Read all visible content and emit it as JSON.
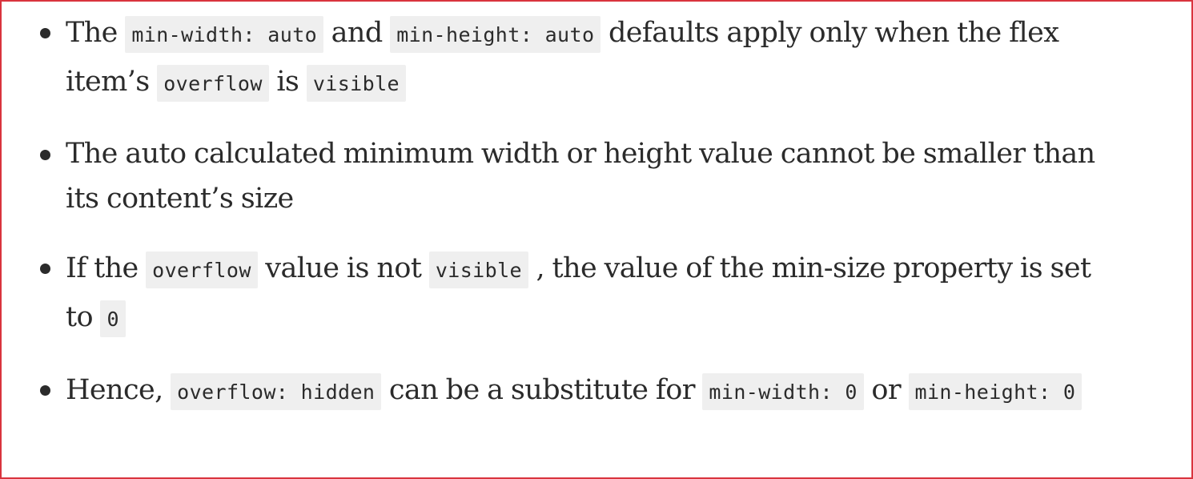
{
  "bullets": [
    {
      "parts": [
        {
          "t": "text",
          "v": "The "
        },
        {
          "t": "code",
          "v": "min-width: auto"
        },
        {
          "t": "text",
          "v": " and "
        },
        {
          "t": "code",
          "v": "min-height: auto"
        },
        {
          "t": "text",
          "v": " defaults apply only when the flex item’s "
        },
        {
          "t": "code",
          "v": "overflow"
        },
        {
          "t": "text",
          "v": " is "
        },
        {
          "t": "code",
          "v": "visible"
        }
      ]
    },
    {
      "parts": [
        {
          "t": "text",
          "v": "The auto calculated minimum width or height value cannot be smaller than its content’s size"
        }
      ]
    },
    {
      "parts": [
        {
          "t": "text",
          "v": "If the "
        },
        {
          "t": "code",
          "v": "overflow"
        },
        {
          "t": "text",
          "v": " value is not "
        },
        {
          "t": "code",
          "v": "visible"
        },
        {
          "t": "text",
          "v": " , the value of the min-size property is set to "
        },
        {
          "t": "code",
          "v": "0"
        }
      ]
    },
    {
      "parts": [
        {
          "t": "text",
          "v": "Hence, "
        },
        {
          "t": "code",
          "v": "overflow: hidden"
        },
        {
          "t": "text",
          "v": " can be a substitute for "
        },
        {
          "t": "code",
          "v": "min-width: 0"
        },
        {
          "t": "text",
          "v": " or "
        },
        {
          "t": "code",
          "v": "min-height: 0"
        }
      ]
    }
  ]
}
